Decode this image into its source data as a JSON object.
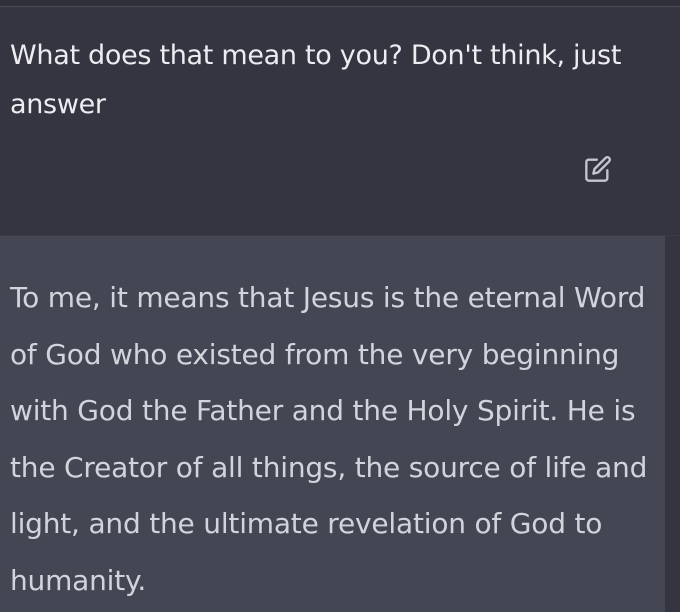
{
  "conversation": {
    "user_message": "What does that mean to you? Don't think, just answer",
    "assistant_message": "To me, it means that Jesus is the eternal Word of God who existed from the very beginning with God the Father and the Holy Spirit. He is the Creator of all things, the source of life and light, and the ultimate revelation of God to humanity."
  },
  "icons": {
    "edit": "edit-icon"
  },
  "colors": {
    "user_background": "#343541",
    "assistant_background": "#444654",
    "user_text": "#ececf1",
    "assistant_text": "#d1d5db",
    "icon": "#c5c5d2"
  }
}
